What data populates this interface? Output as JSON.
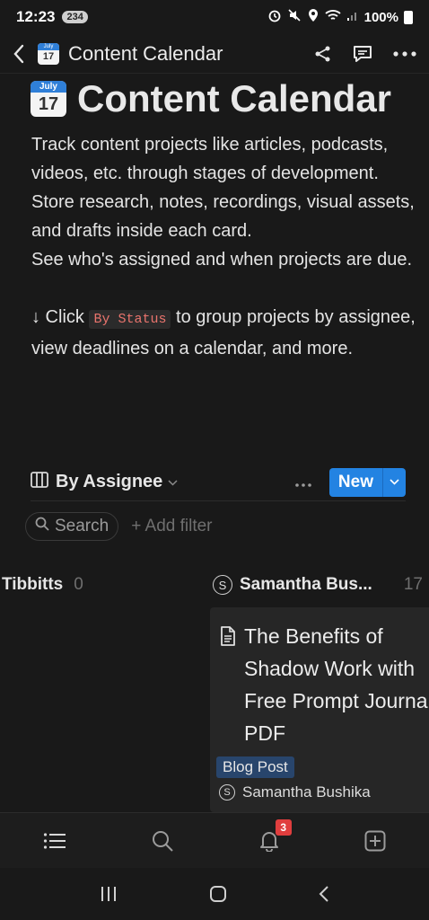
{
  "status_bar": {
    "time": "12:23",
    "badge": "234",
    "battery": "100%"
  },
  "topnav": {
    "title": "Content Calendar",
    "calendar_icon_month": "July",
    "calendar_icon_day": "17"
  },
  "page": {
    "title": "Content Calendar",
    "description_lines": [
      "Track content projects like articles, podcasts, videos, etc. through stages of development.",
      "Store research, notes, recordings, visual assets, and drafts inside each card.",
      "See who's assigned and when projects are due."
    ],
    "hint_prefix": "↓ Click ",
    "hint_code": "By Status",
    "hint_suffix": " to group projects by assignee, view deadlines on a calendar, and more."
  },
  "view": {
    "name": "By Assignee",
    "new_label": "New"
  },
  "filters": {
    "search_label": "Search",
    "add_filter_label": "+ Add filter"
  },
  "groups": [
    {
      "name": "Tibbitts",
      "count": "0"
    },
    {
      "name": "Samantha Bus...",
      "count": "17",
      "avatar_letter": "S"
    }
  ],
  "card": {
    "title": "The Benefits of Shadow Work with Free Prompt Journal PDF",
    "tag": "Blog Post",
    "assignee": "Samantha Bushika",
    "avatar_letter": "S"
  },
  "bottom_nav": {
    "notification_count": "3"
  },
  "colors": {
    "background": "#191919",
    "accent": "#2383e2",
    "tag_bg": "#28456c",
    "code_text": "#e9746d",
    "badge_red": "#e03e3e"
  }
}
